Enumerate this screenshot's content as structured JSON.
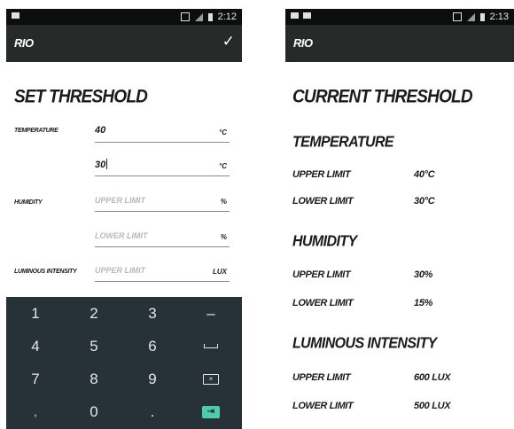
{
  "left_screen": {
    "status": {
      "time": "2:12"
    },
    "toolbar": {
      "title": "RIO",
      "confirm_icon": "checkmark-icon"
    },
    "heading": "SET THRESHOLD",
    "form": {
      "temperature_label": "TEMPERATURE",
      "temperature_upper_value": "40",
      "temperature_lower_value": "30",
      "temperature_unit": "°C",
      "humidity_label": "HUMIDITY",
      "humidity_upper_placeholder": "UPPER LIMIT",
      "humidity_lower_placeholder": "LOWER LIMIT",
      "humidity_unit": "%",
      "luminous_label": "LUMINOUS INTENSITY",
      "luminous_upper_placeholder": "UPPER LIMIT",
      "luminous_unit": "LUX"
    },
    "keypad": {
      "keys": [
        "1",
        "2",
        "3",
        "–",
        "4",
        "5",
        "6",
        "space",
        "7",
        "8",
        "9",
        "backspace",
        ",",
        "0",
        ".",
        "next"
      ]
    }
  },
  "right_screen": {
    "status": {
      "time": "2:13"
    },
    "toolbar": {
      "title": "RIO"
    },
    "heading": "CURRENT THRESHOLD",
    "sections": [
      {
        "title": "TEMPERATURE",
        "rows": [
          {
            "label": "UPPER LIMIT",
            "value": "40°C"
          },
          {
            "label": "LOWER LIMIT",
            "value": "30°C"
          }
        ]
      },
      {
        "title": "HUMIDITY",
        "rows": [
          {
            "label": "UPPER LIMIT",
            "value": "30%"
          },
          {
            "label": "LOWER LIMIT",
            "value": "15%"
          }
        ]
      },
      {
        "title": "LUMINOUS INTENSITY",
        "rows": [
          {
            "label": "UPPER LIMIT",
            "value": "600 LUX"
          },
          {
            "label": "LOWER LIMIT",
            "value": "500 LUX"
          }
        ]
      }
    ]
  }
}
